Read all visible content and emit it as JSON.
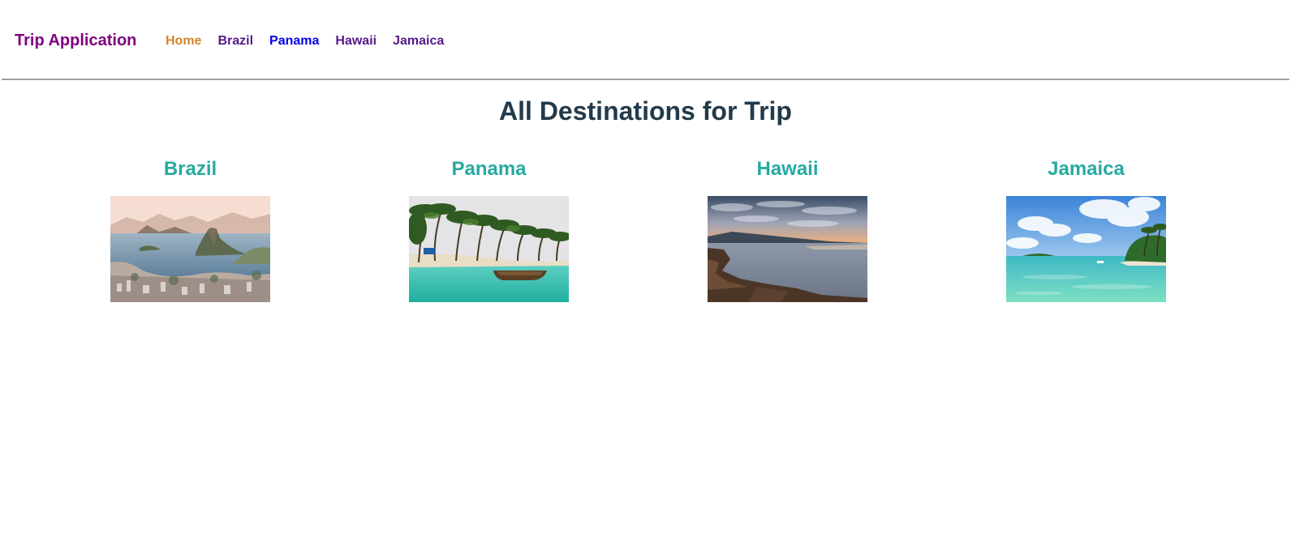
{
  "header": {
    "brand": "Trip Application",
    "nav": [
      {
        "label": "Home"
      },
      {
        "label": "Brazil"
      },
      {
        "label": "Panama"
      },
      {
        "label": "Hawaii"
      },
      {
        "label": "Jamaica"
      }
    ]
  },
  "main": {
    "title": "All Destinations for Trip",
    "destinations": [
      {
        "name": "Brazil",
        "image": "rio-de-janeiro-bay-photo"
      },
      {
        "name": "Panama",
        "image": "palm-beach-canoe-photo"
      },
      {
        "name": "Hawaii",
        "image": "rocky-coast-sunset-photo"
      },
      {
        "name": "Jamaica",
        "image": "tropical-lagoon-photo"
      }
    ]
  },
  "colors": {
    "brand": "#800080",
    "nav_home": "#d2852f",
    "nav_visited": "#551a8b",
    "nav_unvisited": "#0000ee",
    "title": "#233a4a",
    "destination_title": "#26aaa0"
  }
}
